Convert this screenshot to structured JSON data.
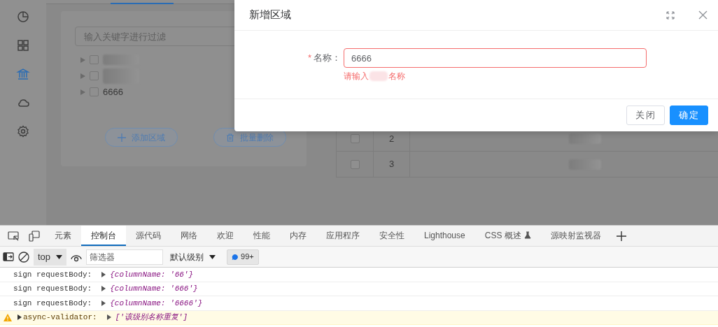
{
  "sidebar": {
    "items": [
      {
        "selected": false
      },
      {
        "selected": false
      },
      {
        "selected": true
      },
      {
        "selected": false
      },
      {
        "selected": false
      }
    ]
  },
  "tree": {
    "filter_placeholder": "输入关键字进行过滤",
    "nodes": [
      {
        "kind": "blurred",
        "checked": false
      },
      {
        "kind": "blurred",
        "checked": false
      },
      {
        "kind": "text",
        "label": "6666",
        "checked": false
      }
    ]
  },
  "tree_buttons": [
    {
      "label": "添加区域",
      "kind": "add"
    },
    {
      "label": "批量删除",
      "kind": "delete"
    }
  ],
  "table": {
    "rows": [
      {
        "index": "2",
        "checked": false
      },
      {
        "index": "3",
        "checked": false
      }
    ]
  },
  "dialog": {
    "title": "新增区域",
    "field": {
      "label": "名称：",
      "required": true,
      "required_mark": "*",
      "value": "6666",
      "invalid": true,
      "error_parts": [
        "请输入",
        "名称"
      ]
    },
    "buttons": [
      {
        "label": "关闭",
        "kind": "default"
      },
      {
        "label": "确定",
        "kind": "primary"
      }
    ]
  },
  "devtools": {
    "tabs": [
      {
        "label": "元素",
        "selected": false
      },
      {
        "label": "控制台",
        "selected": true
      },
      {
        "label": "源代码",
        "selected": false
      },
      {
        "label": "网络",
        "selected": false
      },
      {
        "label": "欢迎",
        "selected": false
      },
      {
        "label": "性能",
        "selected": false
      },
      {
        "label": "内存",
        "selected": false
      },
      {
        "label": "应用程序",
        "selected": false
      },
      {
        "label": "安全性",
        "selected": false
      },
      {
        "label": "Lighthouse",
        "selected": false
      },
      {
        "label": "CSS 概述",
        "selected": false,
        "experimental": true
      },
      {
        "label": "源映射监视器",
        "selected": false
      }
    ],
    "toolbar": {
      "context": "top",
      "filter_placeholder": "筛选器",
      "level": "默认级别",
      "issues_count": "99+"
    },
    "console": [
      {
        "kind": "log",
        "label": "sign requestBody:",
        "object": "{columnName: '66'}"
      },
      {
        "kind": "log",
        "label": "sign requestBody:",
        "object": "{columnName: '666'}"
      },
      {
        "kind": "log",
        "label": "sign requestBody:",
        "object": "{columnName: '6666'}"
      },
      {
        "kind": "warning",
        "label": "async-validator:",
        "object": "['该级别名称重复']"
      }
    ]
  }
}
